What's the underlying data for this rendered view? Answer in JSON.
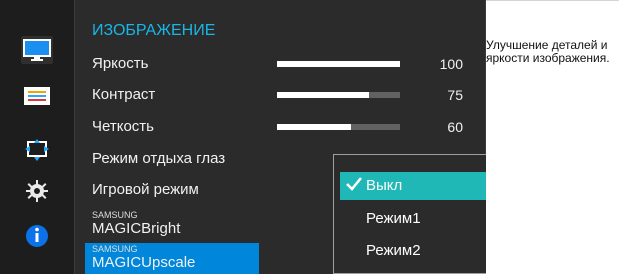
{
  "menu": {
    "title": "ИЗОБРАЖЕНИЕ",
    "items": [
      {
        "label": "Яркость",
        "value": "100",
        "level": 1.0
      },
      {
        "label": "Контраст",
        "value": "75",
        "level": 0.75
      },
      {
        "label": "Четкость",
        "value": "60",
        "level": 0.6
      },
      {
        "label": "Режим отдыха глаз"
      },
      {
        "label": "Игровой режим"
      },
      {
        "label_small": "SAMSUNG",
        "label_main": "MAGIC",
        "label_suffix": "Bright"
      },
      {
        "label_small": "SAMSUNG",
        "label_main": "MAGIC",
        "label_suffix": "Upscale",
        "selected": true
      }
    ]
  },
  "dropdown": {
    "options": [
      {
        "label": "Выкл",
        "selected": true
      },
      {
        "label": "Режим1"
      },
      {
        "label": "Режим2"
      }
    ]
  },
  "help": {
    "text": "Улучшение деталей и яркости изображения."
  },
  "icons": [
    "monitor-icon",
    "settings-bars-icon",
    "screen-size-icon",
    "gear-icon",
    "info-icon"
  ],
  "colors": {
    "accent_blue": "#0087db",
    "accent_teal": "#20b8b6",
    "title_cyan": "#18b7e8",
    "panel_dark": "#2b2b2b"
  }
}
